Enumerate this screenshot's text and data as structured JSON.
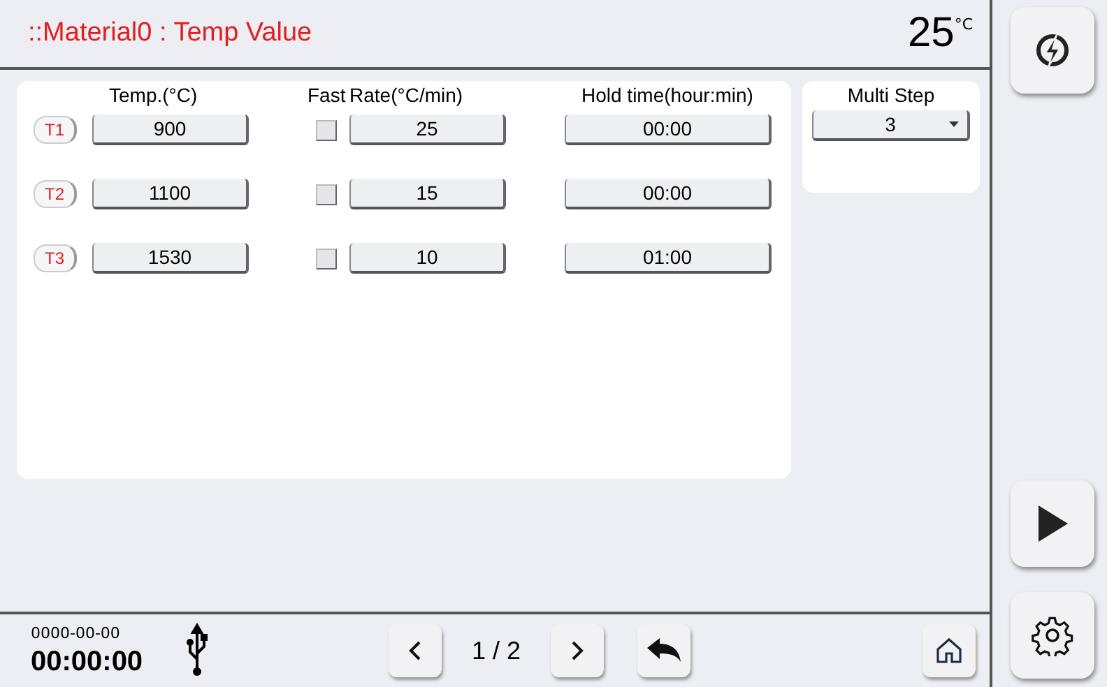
{
  "header": {
    "title": "::Material0 : Temp Value",
    "temperature": "25",
    "temperature_unit": "°C"
  },
  "columns": {
    "temp": "Temp.(°C)",
    "fast": "Fast",
    "rate": "Rate(°C/min)",
    "hold": "Hold time(hour:min)"
  },
  "steps": [
    {
      "tag": "T1",
      "temp": "900",
      "fast": false,
      "rate": "25",
      "hold": "00:00"
    },
    {
      "tag": "T2",
      "temp": "1100",
      "fast": false,
      "rate": "15",
      "hold": "00:00"
    },
    {
      "tag": "T3",
      "temp": "1530",
      "fast": false,
      "rate": "10",
      "hold": "01:00"
    }
  ],
  "multi_step": {
    "label": "Multi Step",
    "value": "3"
  },
  "footer": {
    "date": "0000-00-00",
    "time": "00:00:00",
    "page": "1 / 2"
  }
}
